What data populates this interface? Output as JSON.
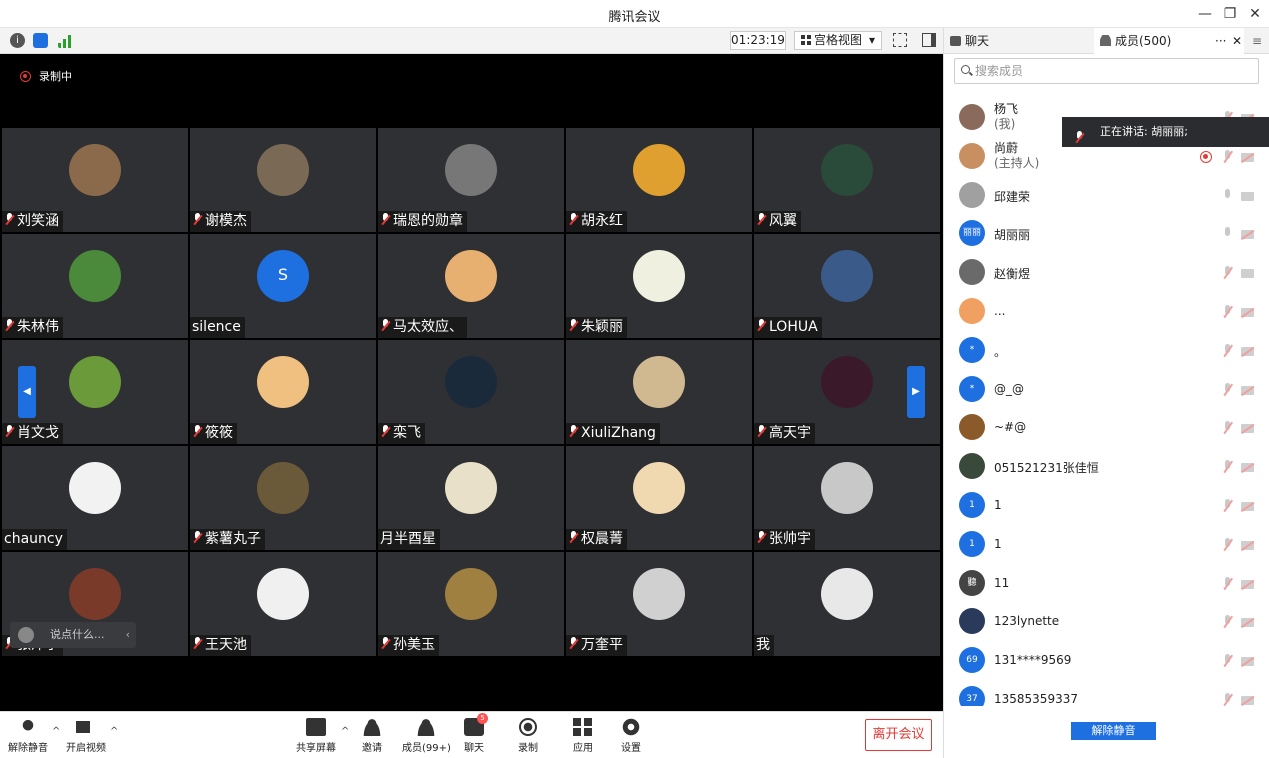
{
  "window": {
    "title": "腾讯会议",
    "minimize": "—",
    "restore": "❐",
    "close": "✕"
  },
  "toolbar": {
    "timer": "01:23:19",
    "view_label": "宫格视图",
    "view_caret": "▾"
  },
  "video": {
    "recording_label": "录制中",
    "participants": [
      {
        "name": "刘笑涵",
        "muted": true,
        "color": "#8a6a4a"
      },
      {
        "name": "谢模杰",
        "muted": true,
        "color": "#7a6a55"
      },
      {
        "name": "瑞恩的勋章",
        "muted": true,
        "color": "#777777"
      },
      {
        "name": "胡永红",
        "muted": true,
        "color": "#e0a030"
      },
      {
        "name": "风翼",
        "muted": true,
        "color": "#2a4a3a"
      },
      {
        "name": "朱林伟",
        "muted": true,
        "color": "#4a8a3a"
      },
      {
        "name": "silence",
        "muted": false,
        "color": "#1e6fe0",
        "initial": "S"
      },
      {
        "name": "马太效应、",
        "muted": true,
        "color": "#e8b070"
      },
      {
        "name": "朱颖丽",
        "muted": true,
        "color": "#f0f0e0"
      },
      {
        "name": "LOHUA",
        "muted": true,
        "color": "#3a5a8a"
      },
      {
        "name": "肖文戈",
        "muted": true,
        "color": "#6a9a3a"
      },
      {
        "name": "筱筱",
        "muted": true,
        "color": "#f0c080"
      },
      {
        "name": "栾飞",
        "muted": true,
        "color": "#1a2a3a"
      },
      {
        "name": "XiuliZhang",
        "muted": true,
        "color": "#d0b890"
      },
      {
        "name": "高天宇",
        "muted": true,
        "color": "#3a1a2a"
      },
      {
        "name": "chauncy",
        "muted": false,
        "color": "#f2f2f2"
      },
      {
        "name": "紫薯丸子",
        "muted": true,
        "color": "#6a5a3a"
      },
      {
        "name": "月半酉星",
        "muted": false,
        "color": "#e8e0c8"
      },
      {
        "name": "权晨菁",
        "muted": true,
        "color": "#f0d8b0"
      },
      {
        "name": "张帅宇",
        "muted": true,
        "color": "#c8c8c8"
      },
      {
        "name": "张泽宇",
        "muted": true,
        "color": "#7a3a2a"
      },
      {
        "name": "王天池",
        "muted": true,
        "color": "#f0f0f0"
      },
      {
        "name": "孙美玉",
        "muted": true,
        "color": "#a08040"
      },
      {
        "name": "万奎平",
        "muted": true,
        "color": "#d0d0d0"
      },
      {
        "name": "我",
        "muted": false,
        "color": "#e8e8e8"
      }
    ],
    "chat_placeholder": "说点什么...",
    "chat_collapse": "‹",
    "nav_left": "◀",
    "nav_right": "▶"
  },
  "bottom": {
    "unmute": "解除静音",
    "video": "开启视频",
    "share": "共享屏幕",
    "invite": "邀请",
    "members": "成员(99+)",
    "chat": "聊天",
    "chat_badge": "5",
    "record": "录制",
    "apps": "应用",
    "settings": "设置",
    "leave": "离开会议",
    "caret": "^"
  },
  "panel": {
    "tab_chat": "聊天",
    "tab_members": "成员(500)",
    "more": "···",
    "close": "✕",
    "menu": "≡",
    "search_placeholder": "搜索成员",
    "speaking_label": "正在讲话: 胡丽丽;",
    "unmute_all": "解除静音",
    "members": [
      {
        "name": "杨飞",
        "sub": "(我)",
        "av": "#8a6a5a",
        "mic": "off",
        "cam": "off"
      },
      {
        "name": "尚蔚",
        "sub": "(主持人)",
        "av": "#c89060",
        "mic": "off",
        "cam": "off",
        "rec": true
      },
      {
        "name": "邱建荣",
        "av": "#a0a0a0",
        "mic": "on",
        "cam": "on"
      },
      {
        "name": "胡丽丽",
        "av": "#1e6fe0",
        "initial": "丽丽",
        "mic": "on",
        "cam": "off"
      },
      {
        "name": "赵衡煜",
        "av": "#6a6a6a",
        "mic": "off",
        "cam": "on"
      },
      {
        "name": "...",
        "av": "#f0a060",
        "mic": "off",
        "cam": "off"
      },
      {
        "name": "。",
        "av": "#1e6fe0",
        "initial": "*",
        "mic": "off",
        "cam": "off"
      },
      {
        "name": "@_@",
        "av": "#1e6fe0",
        "initial": "*",
        "mic": "off",
        "cam": "off"
      },
      {
        "name": "~#@",
        "av": "#8a5a2a",
        "mic": "off",
        "cam": "off"
      },
      {
        "name": "051521231张佳恒",
        "av": "#3a4a3a",
        "mic": "off",
        "cam": "off"
      },
      {
        "name": "1",
        "av": "#1e6fe0",
        "initial": "1",
        "mic": "off",
        "cam": "off"
      },
      {
        "name": "1",
        "av": "#1e6fe0",
        "initial": "1",
        "mic": "off",
        "cam": "off"
      },
      {
        "name": "11",
        "av": "#444444",
        "initial": "聽",
        "mic": "off",
        "cam": "off"
      },
      {
        "name": "123lynette",
        "av": "#2a3a5a",
        "mic": "off",
        "cam": "off"
      },
      {
        "name": "131****9569",
        "av": "#1e6fe0",
        "initial": "69",
        "mic": "off",
        "cam": "off"
      },
      {
        "name": "13585359337",
        "av": "#1e6fe0",
        "initial": "37",
        "mic": "off",
        "cam": "off"
      }
    ]
  }
}
